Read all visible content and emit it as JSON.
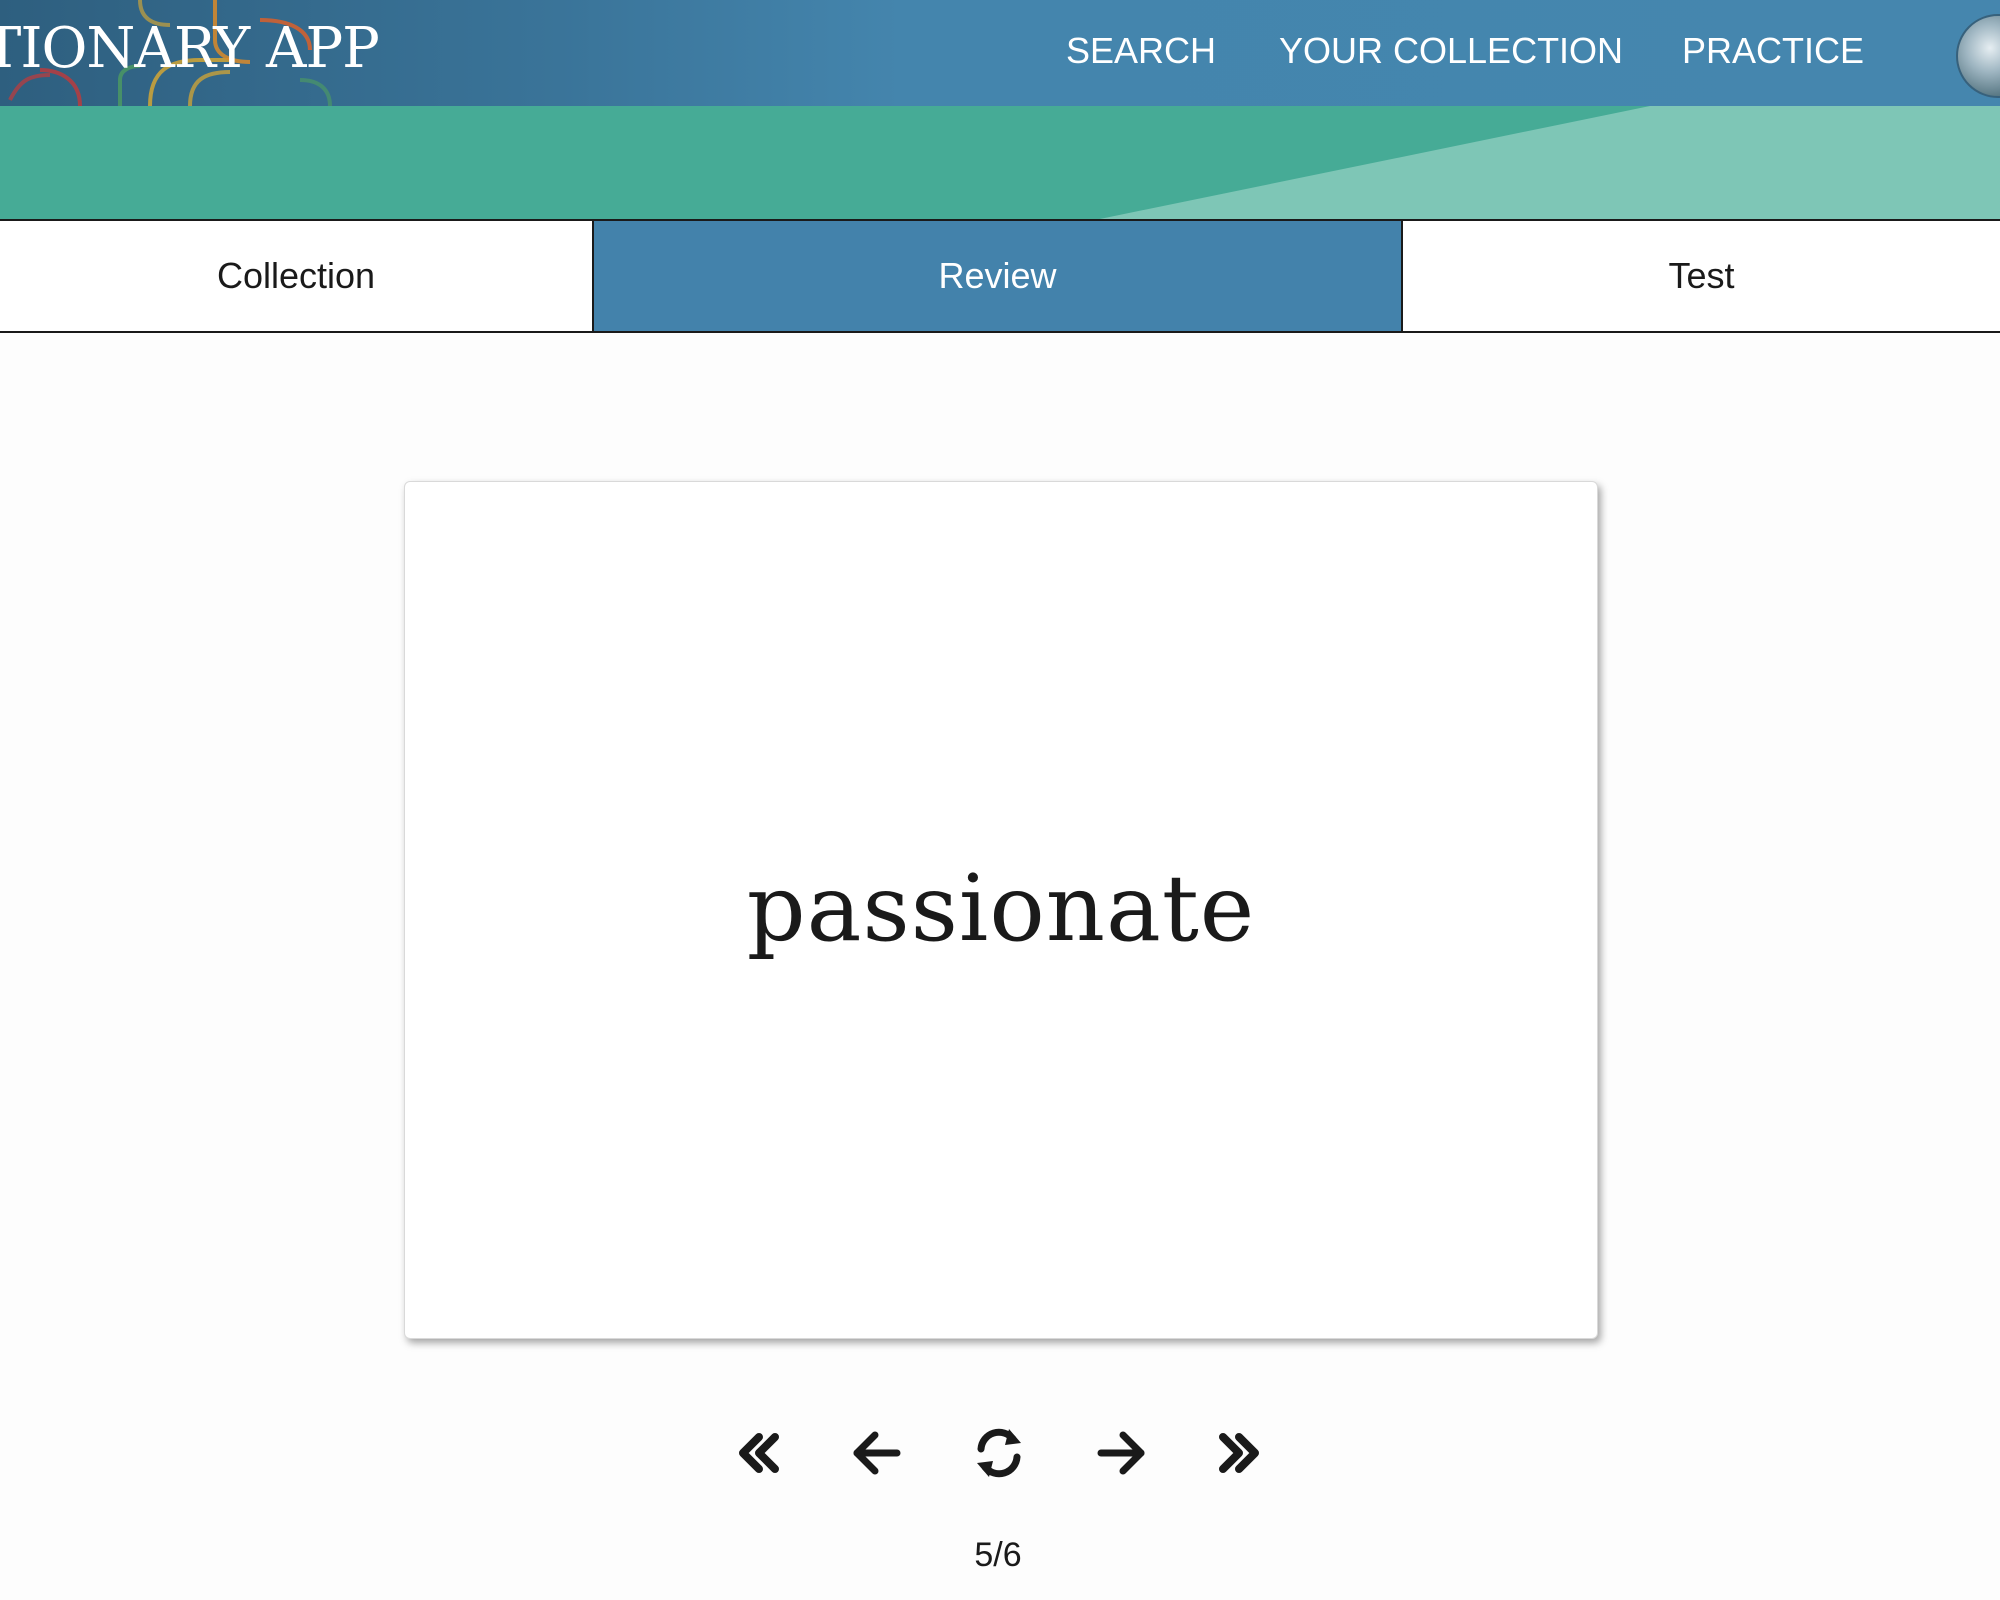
{
  "app": {
    "logo_text": "TIONARY APP"
  },
  "nav": {
    "search": "SEARCH",
    "collection": "YOUR COLLECTION",
    "practice": "PRACTICE"
  },
  "tabs": [
    {
      "label": "Collection",
      "active": false
    },
    {
      "label": "Review",
      "active": true
    },
    {
      "label": "Test",
      "active": false
    }
  ],
  "card": {
    "word": "passionate"
  },
  "controls": {
    "icons": [
      "double-chevron-left-icon",
      "arrow-left-icon",
      "refresh-icon",
      "arrow-right-icon",
      "double-chevron-right-icon"
    ]
  },
  "progress": {
    "text": "5/6",
    "current": 5,
    "total": 6
  },
  "colors": {
    "header": "#4586ae",
    "active_tab": "#4382ab",
    "band_teal": "#46ab96",
    "band_light": "#7ec6b6"
  }
}
